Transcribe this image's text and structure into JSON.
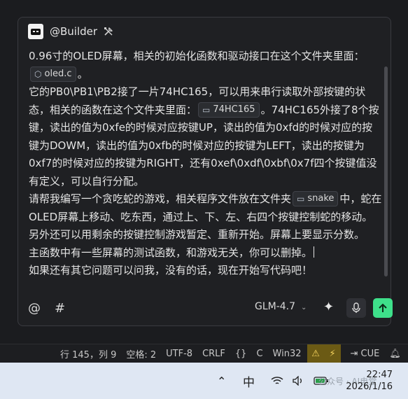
{
  "panel": {
    "agent_name": "@Builder",
    "icons": {
      "agent": "robot-icon",
      "tools": "tools-icon"
    }
  },
  "message": {
    "line1": "0.96寸的OLED屏幕，相关的初始化函数和驱动接口在这个文件夹里面：",
    "chip_oled": "oled.c",
    "line1_end": "。",
    "line2a": "它的PB0\\PB1\\PB2接了一片74HC165，可以用来串行读取外部按键的状态，相关的函数在这个文件夹里面：",
    "chip_74hc165": "74HC165",
    "line2b": "。74HC165外接了8个按键，读出的值为0xfe的时候对应按键UP，读出的值为0xfd的时候对应的按键为DOWM，读出的值为0xfb的时候对应的按键为LEFT，读出的按键为0xf7的时候对应的按键为RIGHT，还有0xef\\0xdf\\0xbf\\0x7f四个按键值没有定义，可以自行分配。",
    "line3a": "请帮我编写一个贪吃蛇的游戏，相关程序文件放在文件夹",
    "chip_snake": "snake",
    "line3b": "中，蛇在OLED屏幕上移动、吃东西，通过上、下、左、右四个按键控制蛇的移动。另外还可以用剩余的按键控制游戏暂定、重新开始。屏幕上要显示分数。",
    "line4": "主函数中有一些屏幕的测试函数，和游戏无关，你可以删掉。",
    "line5": "如果还有其它问题可以问我，没有的话，现在开始写代码吧！"
  },
  "toolbar": {
    "mention_symbol": "@",
    "hash_symbol": "#",
    "model": "GLM-4.7"
  },
  "statusbar": {
    "position": "行 145，列 9",
    "spaces": "空格: 2",
    "encoding": "UTF-8",
    "eol": "CRLF",
    "braces": "{}",
    "language": "C",
    "platform": "Win32",
    "cue": "CUE"
  },
  "taskbar": {
    "ime": "中",
    "time": "22:47",
    "date": "2026/1/16",
    "watermark": "公众号 · AI电堂"
  },
  "colors": {
    "accent_send": "#3ee08a",
    "warning_bg": "#6b5a14",
    "panel_bg": "#1f2023"
  }
}
